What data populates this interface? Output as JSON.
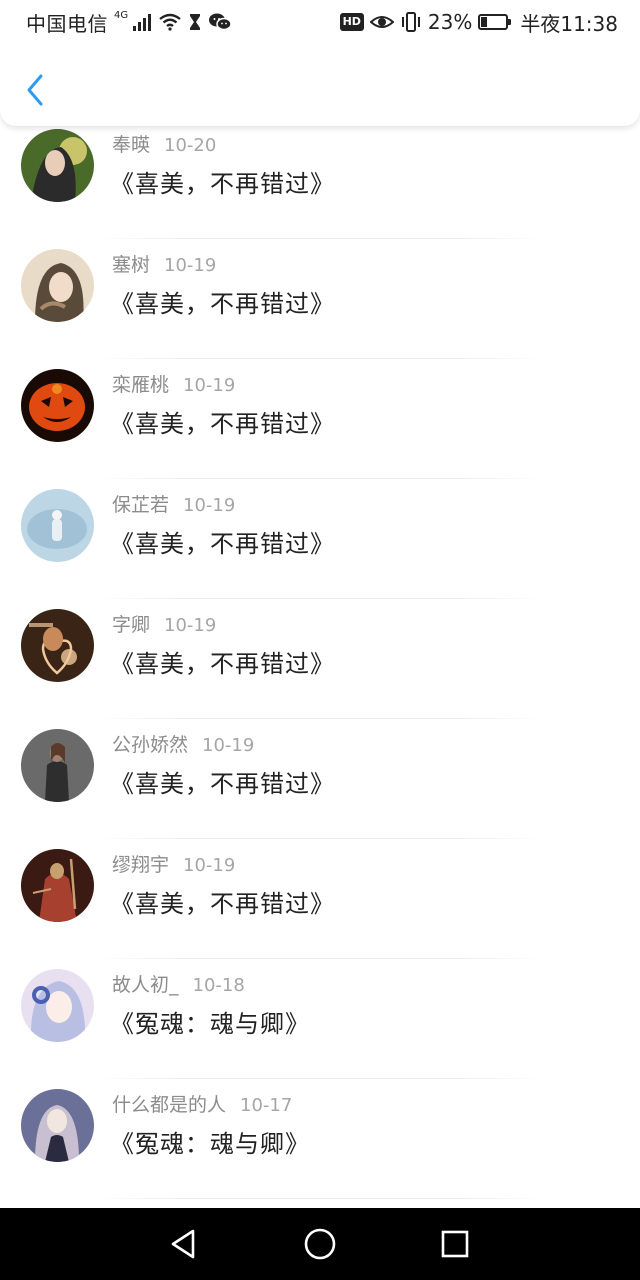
{
  "status_bar": {
    "carrier": "中国电信",
    "network": "4G",
    "hd_label": "HD",
    "battery_percent": "23%",
    "battery_level": 0.23,
    "time": "半夜11:38"
  },
  "header": {
    "back_icon": "chevron-left-icon",
    "accent_color": "#2b9cf2"
  },
  "list": {
    "items": [
      {
        "name": "奉暎",
        "date": "10-20",
        "title": "《喜美，不再错过》",
        "avatar_colors": [
          "#4a6a2a",
          "#c9c36a",
          "#2b2b2b"
        ]
      },
      {
        "name": "塞树",
        "date": "10-19",
        "title": "《喜美，不再错过》",
        "avatar_colors": [
          "#e8dcc8",
          "#a88a6a",
          "#5a4a3a"
        ]
      },
      {
        "name": "栾雁桃",
        "date": "10-19",
        "title": "《喜美，不再错过》",
        "avatar_colors": [
          "#1a0a06",
          "#e04a10",
          "#f08a20"
        ]
      },
      {
        "name": "保芷若",
        "date": "10-19",
        "title": "《喜美，不再错过》",
        "avatar_colors": [
          "#bcd6e6",
          "#8fb4cc",
          "#e8f0f4"
        ]
      },
      {
        "name": "字卿",
        "date": "10-19",
        "title": "《喜美，不再错过》",
        "avatar_colors": [
          "#3a2416",
          "#c88a5a",
          "#f0c89a"
        ]
      },
      {
        "name": "公孙娇然",
        "date": "10-19",
        "title": "《喜美，不再错过》",
        "avatar_colors": [
          "#6a6a6a",
          "#2e2e2e",
          "#a08070"
        ]
      },
      {
        "name": "缪翔宇",
        "date": "10-19",
        "title": "《喜美，不再错过》",
        "avatar_colors": [
          "#3a1a12",
          "#a84030",
          "#c8a070"
        ]
      },
      {
        "name": "故人初_",
        "date": "10-18",
        "title": "《冤魂：魂与卿》",
        "avatar_colors": [
          "#e8e0f0",
          "#9aa8d8",
          "#4a60b0"
        ]
      },
      {
        "name": "什么都是的人",
        "date": "10-17",
        "title": "《冤魂：魂与卿》",
        "avatar_colors": [
          "#6a7098",
          "#c8c0d0",
          "#2a2a40"
        ]
      }
    ]
  },
  "nav_bar": {
    "back_icon": "triangle-back-icon",
    "home_icon": "circle-home-icon",
    "recents_icon": "square-recents-icon"
  }
}
